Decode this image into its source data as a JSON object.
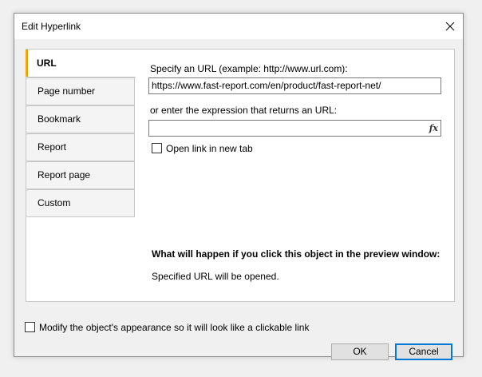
{
  "window": {
    "title": "Edit Hyperlink"
  },
  "tabs": [
    {
      "label": "URL",
      "active": true
    },
    {
      "label": "Page number",
      "active": false
    },
    {
      "label": "Bookmark",
      "active": false
    },
    {
      "label": "Report",
      "active": false
    },
    {
      "label": "Report page",
      "active": false
    },
    {
      "label": "Custom",
      "active": false
    }
  ],
  "url_tab": {
    "url_label": "Specify an URL (example: http://www.url.com):",
    "url_value": "https://www.fast-report.com/en/product/fast-report-net/",
    "expr_label": "or enter the expression that returns an URL:",
    "expr_value": "",
    "expr_button": "fx",
    "new_tab_label": "Open link in new tab",
    "new_tab_checked": false,
    "info_heading": "What will happen if you click this object in the preview window:",
    "info_text": "Specified URL will be opened."
  },
  "footer": {
    "modify_label": "Modify the object's appearance so it will look like a clickable link",
    "modify_checked": false,
    "ok_label": "OK",
    "cancel_label": "Cancel"
  },
  "colors": {
    "active_tab_accent": "#f0a30a",
    "default_button_border": "#0078d7"
  }
}
